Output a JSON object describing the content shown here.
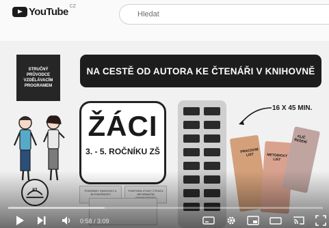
{
  "header": {
    "logo_text": "YouTube",
    "country_code": "CZ",
    "search": {
      "placeholder": "Hledat"
    }
  },
  "video": {
    "info_box_text": "STRUČNÝ PRŮVODCE VZDĚLÁVACÍM PROGRAMEM",
    "title_banner": "NA CESTĚ OD AUTORA KE ČTENÁŘI V KNIHOVNĚ",
    "target_word": "ŽÁCI",
    "target_grade": "3. - 5. ROČNÍKU ZŠ",
    "duration_note": "16 X 45 MIN.",
    "box_left_text": "PODMÍNKY KNIHOVNY A JEJÍ MOŽNOSTI",
    "box_right_text": "PODPORA VÝUKY ČTENÍ A INFORMAČNÍ GRAMOTNOSTI",
    "book_1": "PRACOVNÍ LIST",
    "book_2": "METODICKÝ LIST",
    "book_3": "KLÍČ ŘEŠENÍ"
  },
  "player": {
    "time_display": "0:58 / 3:09",
    "progress_fraction": 0.307
  },
  "colors": {
    "banner_bg": "#1d1d1d",
    "page_bg": "#ffffff",
    "video_bg": "#f1f1f1"
  }
}
